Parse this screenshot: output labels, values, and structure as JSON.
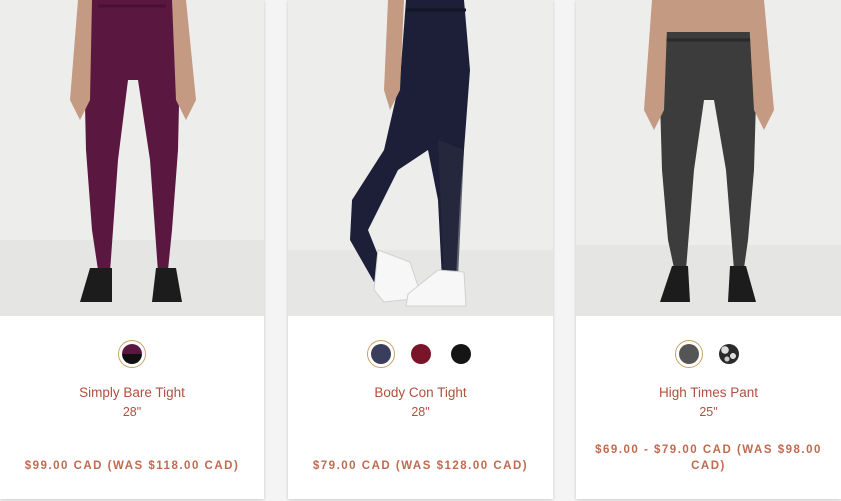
{
  "products": [
    {
      "name": "Simply Bare Tight",
      "size": "28\"",
      "price": "$99.00 CAD (WAS $118.00 CAD)",
      "image_alt": "Simply Bare Tight product photo",
      "legging_color": "#5a1840",
      "swatches": [
        {
          "name": "plum-black",
          "colors": [
            "#5a1840",
            "#111111"
          ],
          "selected": true
        }
      ]
    },
    {
      "name": "Body Con Tight",
      "size": "28\"",
      "price": "$79.00 CAD (WAS $128.00 CAD)",
      "image_alt": "Body Con Tight product photo",
      "legging_color": "#1d1f38",
      "swatches": [
        {
          "name": "navy",
          "colors": [
            "#3a3e5c"
          ],
          "selected": true
        },
        {
          "name": "burgundy",
          "colors": [
            "#7a1428"
          ],
          "selected": false
        },
        {
          "name": "black",
          "colors": [
            "#151515"
          ],
          "selected": false
        }
      ]
    },
    {
      "name": "High Times Pant",
      "size": "25\"",
      "price": "$69.00 - $79.00 CAD (WAS $98.00 CAD)",
      "image_alt": "High Times Pant product photo",
      "legging_color": "#3c3c3c",
      "swatches": [
        {
          "name": "heathered-grey",
          "colors": [
            "#555555"
          ],
          "selected": true
        },
        {
          "name": "black-print",
          "colors": [
            "#2a2a2a",
            "#dddddd"
          ],
          "selected": false
        }
      ]
    }
  ]
}
